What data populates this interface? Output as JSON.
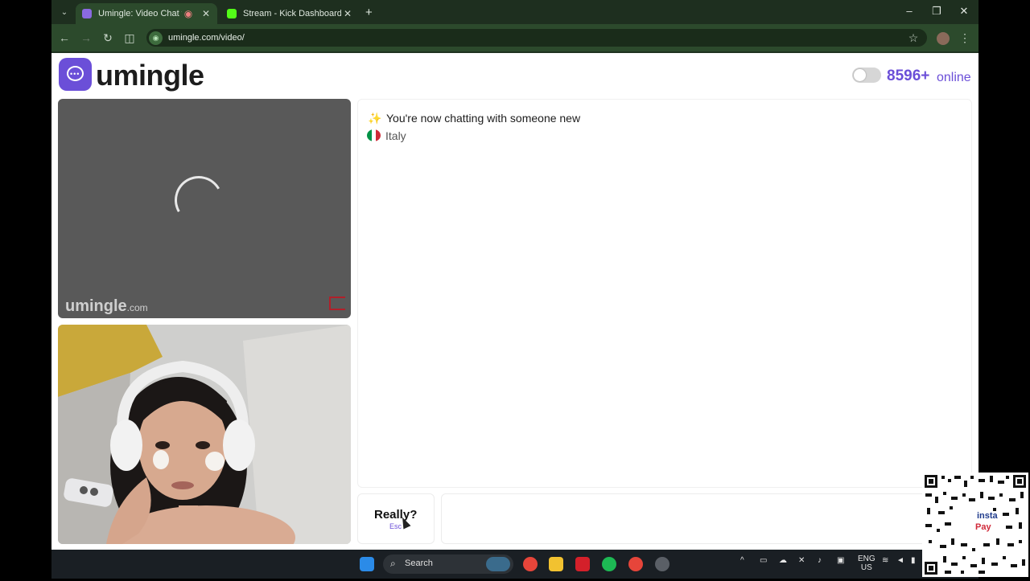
{
  "browser": {
    "tabs": [
      {
        "title": "Umingle: Video Chat with S",
        "active": true
      },
      {
        "title": "Stream - Kick Dashboard",
        "active": false
      }
    ],
    "new_tab": "+",
    "url": "umingle.com/video/",
    "window": {
      "minimize": "–",
      "restore": "❐",
      "close": "✕"
    }
  },
  "site": {
    "logo_text": "umingle",
    "online_count": "8596+",
    "online_label": "online",
    "brand_color": "#6b4fd8"
  },
  "video": {
    "watermark": "umingle",
    "watermark_suffix": ".com"
  },
  "chat": {
    "system_message": "You're now chatting with someone new",
    "country": "Italy"
  },
  "controls": {
    "skip_label": "Really?",
    "skip_hint": "Esc"
  },
  "taskbar": {
    "search_label": "Search",
    "lang_top": "ENG",
    "lang_bottom": "US"
  },
  "overlay": {
    "qr_label_1": "insta",
    "qr_label_2": "Pay"
  }
}
